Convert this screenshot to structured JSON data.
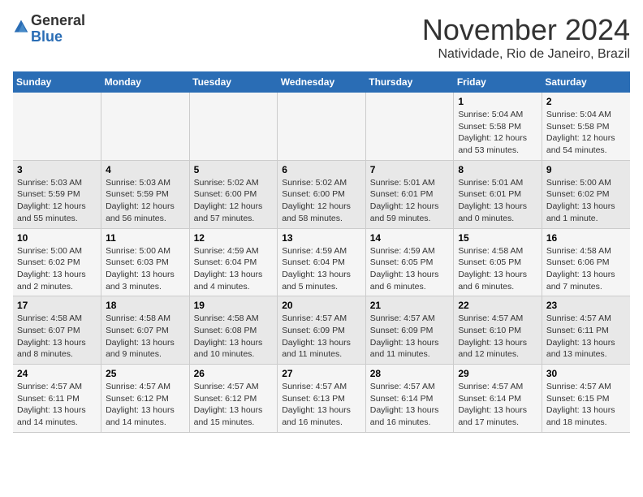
{
  "header": {
    "logo_line1": "General",
    "logo_line2": "Blue",
    "month": "November 2024",
    "location": "Natividade, Rio de Janeiro, Brazil"
  },
  "days_of_week": [
    "Sunday",
    "Monday",
    "Tuesday",
    "Wednesday",
    "Thursday",
    "Friday",
    "Saturday"
  ],
  "weeks": [
    [
      {
        "day": "",
        "info": ""
      },
      {
        "day": "",
        "info": ""
      },
      {
        "day": "",
        "info": ""
      },
      {
        "day": "",
        "info": ""
      },
      {
        "day": "",
        "info": ""
      },
      {
        "day": "1",
        "info": "Sunrise: 5:04 AM\nSunset: 5:58 PM\nDaylight: 12 hours\nand 53 minutes."
      },
      {
        "day": "2",
        "info": "Sunrise: 5:04 AM\nSunset: 5:58 PM\nDaylight: 12 hours\nand 54 minutes."
      }
    ],
    [
      {
        "day": "3",
        "info": "Sunrise: 5:03 AM\nSunset: 5:59 PM\nDaylight: 12 hours\nand 55 minutes."
      },
      {
        "day": "4",
        "info": "Sunrise: 5:03 AM\nSunset: 5:59 PM\nDaylight: 12 hours\nand 56 minutes."
      },
      {
        "day": "5",
        "info": "Sunrise: 5:02 AM\nSunset: 6:00 PM\nDaylight: 12 hours\nand 57 minutes."
      },
      {
        "day": "6",
        "info": "Sunrise: 5:02 AM\nSunset: 6:00 PM\nDaylight: 12 hours\nand 58 minutes."
      },
      {
        "day": "7",
        "info": "Sunrise: 5:01 AM\nSunset: 6:01 PM\nDaylight: 12 hours\nand 59 minutes."
      },
      {
        "day": "8",
        "info": "Sunrise: 5:01 AM\nSunset: 6:01 PM\nDaylight: 13 hours\nand 0 minutes."
      },
      {
        "day": "9",
        "info": "Sunrise: 5:00 AM\nSunset: 6:02 PM\nDaylight: 13 hours\nand 1 minute."
      }
    ],
    [
      {
        "day": "10",
        "info": "Sunrise: 5:00 AM\nSunset: 6:02 PM\nDaylight: 13 hours\nand 2 minutes."
      },
      {
        "day": "11",
        "info": "Sunrise: 5:00 AM\nSunset: 6:03 PM\nDaylight: 13 hours\nand 3 minutes."
      },
      {
        "day": "12",
        "info": "Sunrise: 4:59 AM\nSunset: 6:04 PM\nDaylight: 13 hours\nand 4 minutes."
      },
      {
        "day": "13",
        "info": "Sunrise: 4:59 AM\nSunset: 6:04 PM\nDaylight: 13 hours\nand 5 minutes."
      },
      {
        "day": "14",
        "info": "Sunrise: 4:59 AM\nSunset: 6:05 PM\nDaylight: 13 hours\nand 6 minutes."
      },
      {
        "day": "15",
        "info": "Sunrise: 4:58 AM\nSunset: 6:05 PM\nDaylight: 13 hours\nand 6 minutes."
      },
      {
        "day": "16",
        "info": "Sunrise: 4:58 AM\nSunset: 6:06 PM\nDaylight: 13 hours\nand 7 minutes."
      }
    ],
    [
      {
        "day": "17",
        "info": "Sunrise: 4:58 AM\nSunset: 6:07 PM\nDaylight: 13 hours\nand 8 minutes."
      },
      {
        "day": "18",
        "info": "Sunrise: 4:58 AM\nSunset: 6:07 PM\nDaylight: 13 hours\nand 9 minutes."
      },
      {
        "day": "19",
        "info": "Sunrise: 4:58 AM\nSunset: 6:08 PM\nDaylight: 13 hours\nand 10 minutes."
      },
      {
        "day": "20",
        "info": "Sunrise: 4:57 AM\nSunset: 6:09 PM\nDaylight: 13 hours\nand 11 minutes."
      },
      {
        "day": "21",
        "info": "Sunrise: 4:57 AM\nSunset: 6:09 PM\nDaylight: 13 hours\nand 11 minutes."
      },
      {
        "day": "22",
        "info": "Sunrise: 4:57 AM\nSunset: 6:10 PM\nDaylight: 13 hours\nand 12 minutes."
      },
      {
        "day": "23",
        "info": "Sunrise: 4:57 AM\nSunset: 6:11 PM\nDaylight: 13 hours\nand 13 minutes."
      }
    ],
    [
      {
        "day": "24",
        "info": "Sunrise: 4:57 AM\nSunset: 6:11 PM\nDaylight: 13 hours\nand 14 minutes."
      },
      {
        "day": "25",
        "info": "Sunrise: 4:57 AM\nSunset: 6:12 PM\nDaylight: 13 hours\nand 14 minutes."
      },
      {
        "day": "26",
        "info": "Sunrise: 4:57 AM\nSunset: 6:12 PM\nDaylight: 13 hours\nand 15 minutes."
      },
      {
        "day": "27",
        "info": "Sunrise: 4:57 AM\nSunset: 6:13 PM\nDaylight: 13 hours\nand 16 minutes."
      },
      {
        "day": "28",
        "info": "Sunrise: 4:57 AM\nSunset: 6:14 PM\nDaylight: 13 hours\nand 16 minutes."
      },
      {
        "day": "29",
        "info": "Sunrise: 4:57 AM\nSunset: 6:14 PM\nDaylight: 13 hours\nand 17 minutes."
      },
      {
        "day": "30",
        "info": "Sunrise: 4:57 AM\nSunset: 6:15 PM\nDaylight: 13 hours\nand 18 minutes."
      }
    ]
  ]
}
